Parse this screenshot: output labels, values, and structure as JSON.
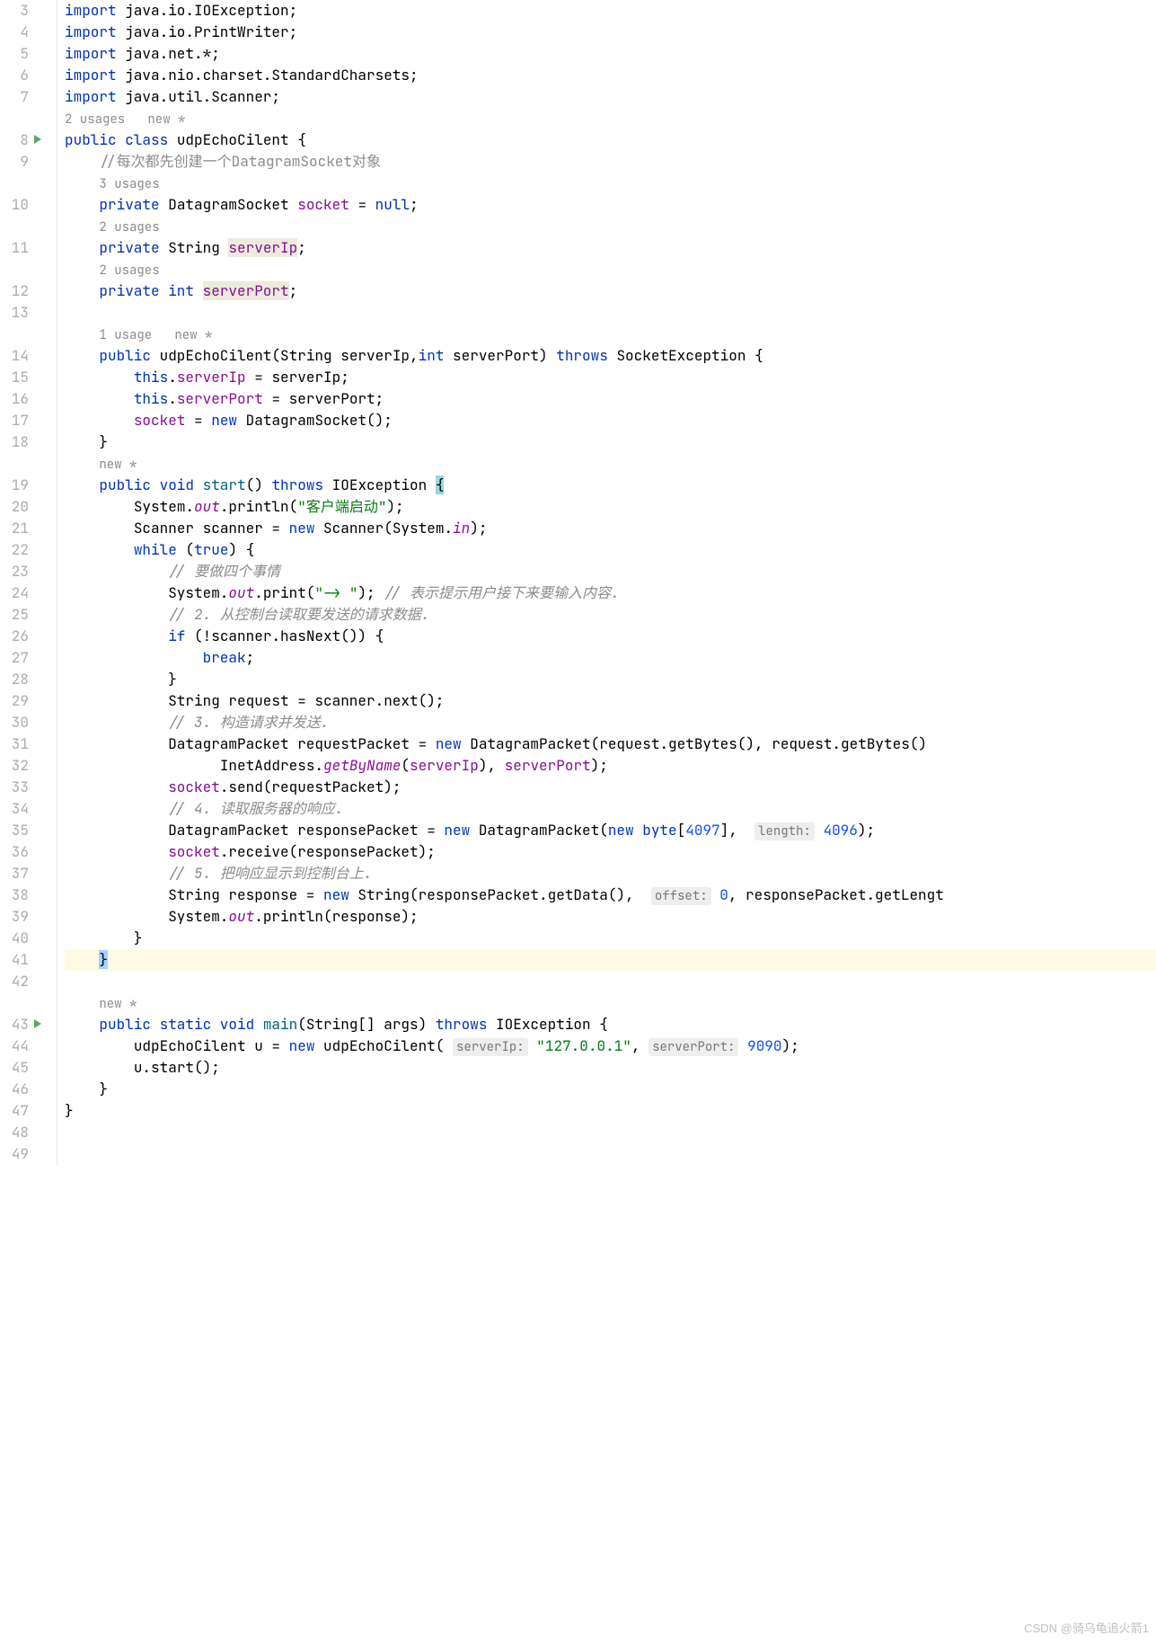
{
  "watermark": "CSDN @骑乌龟追火箭1",
  "lines": [
    {
      "num": "3",
      "indent": 0,
      "tokens": [
        {
          "t": "import ",
          "c": "kw"
        },
        {
          "t": "java.io.IOException;",
          "c": ""
        }
      ]
    },
    {
      "num": "4",
      "indent": 0,
      "tokens": [
        {
          "t": "import ",
          "c": "kw"
        },
        {
          "t": "java.io.PrintWriter;",
          "c": ""
        }
      ]
    },
    {
      "num": "5",
      "indent": 0,
      "tokens": [
        {
          "t": "import ",
          "c": "kw"
        },
        {
          "t": "java.net.*;",
          "c": ""
        }
      ]
    },
    {
      "num": "6",
      "indent": 0,
      "tokens": [
        {
          "t": "import ",
          "c": "kw"
        },
        {
          "t": "java.nio.charset.StandardCharsets;",
          "c": ""
        }
      ]
    },
    {
      "num": "7",
      "indent": 0,
      "tokens": [
        {
          "t": "import ",
          "c": "kw"
        },
        {
          "t": "java.util.Scanner;",
          "c": ""
        }
      ]
    },
    {
      "num": "",
      "indent": 0,
      "hint": true,
      "tokens": [
        {
          "t": "2 usages   new *",
          "c": "hint-line"
        }
      ]
    },
    {
      "num": "8",
      "indent": 0,
      "run": true,
      "tokens": [
        {
          "t": "public class ",
          "c": "kw"
        },
        {
          "t": "udpEchoCilent {",
          "c": ""
        }
      ]
    },
    {
      "num": "9",
      "indent": 1,
      "tokens": [
        {
          "t": "//每次都先创建一个DatagramSocket对象",
          "c": "comment-green"
        }
      ]
    },
    {
      "num": "",
      "indent": 1,
      "hint": true,
      "tokens": [
        {
          "t": "3 usages",
          "c": "hint-line"
        }
      ]
    },
    {
      "num": "10",
      "indent": 1,
      "tokens": [
        {
          "t": "private ",
          "c": "kw"
        },
        {
          "t": "DatagramSocket ",
          "c": ""
        },
        {
          "t": "socket",
          "c": "field"
        },
        {
          "t": " = ",
          "c": ""
        },
        {
          "t": "null",
          "c": "kw"
        },
        {
          "t": ";",
          "c": ""
        }
      ]
    },
    {
      "num": "",
      "indent": 1,
      "hint": true,
      "tokens": [
        {
          "t": "2 usages",
          "c": "hint-line"
        }
      ]
    },
    {
      "num": "11",
      "indent": 1,
      "tokens": [
        {
          "t": "private ",
          "c": "kw"
        },
        {
          "t": "String ",
          "c": ""
        },
        {
          "t": "serverIp",
          "c": "field usage-hl"
        },
        {
          "t": ";",
          "c": ""
        }
      ]
    },
    {
      "num": "",
      "indent": 1,
      "hint": true,
      "tokens": [
        {
          "t": "2 usages",
          "c": "hint-line"
        }
      ]
    },
    {
      "num": "12",
      "indent": 1,
      "tokens": [
        {
          "t": "private int ",
          "c": "kw"
        },
        {
          "t": "serverPort",
          "c": "field usage-hl"
        },
        {
          "t": ";",
          "c": ""
        }
      ]
    },
    {
      "num": "13",
      "indent": 0,
      "tokens": []
    },
    {
      "num": "",
      "indent": 1,
      "hint": true,
      "tokens": [
        {
          "t": "1 usage   new *",
          "c": "hint-line"
        }
      ]
    },
    {
      "num": "14",
      "indent": 1,
      "tokens": [
        {
          "t": "public ",
          "c": "kw"
        },
        {
          "t": "udpEchoCilent",
          "c": ""
        },
        {
          "t": "(String serverIp,",
          "c": ""
        },
        {
          "t": "int ",
          "c": "kw"
        },
        {
          "t": "serverPort) ",
          "c": ""
        },
        {
          "t": "throws ",
          "c": "kw"
        },
        {
          "t": "SocketException {",
          "c": ""
        }
      ]
    },
    {
      "num": "15",
      "indent": 2,
      "tokens": [
        {
          "t": "this",
          "c": "kw"
        },
        {
          "t": ".",
          "c": ""
        },
        {
          "t": "serverIp",
          "c": "field"
        },
        {
          "t": " = serverIp;",
          "c": ""
        }
      ]
    },
    {
      "num": "16",
      "indent": 2,
      "tokens": [
        {
          "t": "this",
          "c": "kw"
        },
        {
          "t": ".",
          "c": ""
        },
        {
          "t": "serverPort",
          "c": "field"
        },
        {
          "t": " = serverPort;",
          "c": ""
        }
      ]
    },
    {
      "num": "17",
      "indent": 2,
      "tokens": [
        {
          "t": "socket",
          "c": "field"
        },
        {
          "t": " = ",
          "c": ""
        },
        {
          "t": "new ",
          "c": "kw"
        },
        {
          "t": "DatagramSocket();",
          "c": ""
        }
      ]
    },
    {
      "num": "18",
      "indent": 1,
      "tokens": [
        {
          "t": "}",
          "c": ""
        }
      ]
    },
    {
      "num": "",
      "indent": 1,
      "hint": true,
      "tokens": [
        {
          "t": "new *",
          "c": "hint-line"
        }
      ]
    },
    {
      "num": "19",
      "indent": 1,
      "tokens": [
        {
          "t": "public void ",
          "c": "kw"
        },
        {
          "t": "start",
          "c": "method"
        },
        {
          "t": "() ",
          "c": ""
        },
        {
          "t": "throws ",
          "c": "kw"
        },
        {
          "t": "IOException ",
          "c": ""
        },
        {
          "t": "{",
          "c": "brace-hl"
        }
      ]
    },
    {
      "num": "20",
      "indent": 2,
      "tokens": [
        {
          "t": "System.",
          "c": ""
        },
        {
          "t": "out",
          "c": "static-field"
        },
        {
          "t": ".println(",
          "c": ""
        },
        {
          "t": "\"客户端启动\"",
          "c": "str"
        },
        {
          "t": ");",
          "c": ""
        }
      ]
    },
    {
      "num": "21",
      "indent": 2,
      "tokens": [
        {
          "t": "Scanner scanner = ",
          "c": ""
        },
        {
          "t": "new ",
          "c": "kw"
        },
        {
          "t": "Scanner(System.",
          "c": ""
        },
        {
          "t": "in",
          "c": "static-field"
        },
        {
          "t": ");",
          "c": ""
        }
      ]
    },
    {
      "num": "22",
      "indent": 2,
      "tokens": [
        {
          "t": "while ",
          "c": "kw"
        },
        {
          "t": "(",
          "c": ""
        },
        {
          "t": "true",
          "c": "kw"
        },
        {
          "t": ") {",
          "c": ""
        }
      ]
    },
    {
      "num": "23",
      "indent": 3,
      "tokens": [
        {
          "t": "// 要做四个事情",
          "c": "comment"
        }
      ]
    },
    {
      "num": "24",
      "indent": 3,
      "tokens": [
        {
          "t": "System.",
          "c": ""
        },
        {
          "t": "out",
          "c": "static-field"
        },
        {
          "t": ".print(",
          "c": ""
        },
        {
          "t": "\"-> \"",
          "c": "str"
        },
        {
          "t": "); ",
          "c": ""
        },
        {
          "t": "// 表示提示用户接下来要输入内容.",
          "c": "comment"
        }
      ]
    },
    {
      "num": "25",
      "indent": 3,
      "tokens": [
        {
          "t": "// 2. 从控制台读取要发送的请求数据.",
          "c": "comment"
        }
      ]
    },
    {
      "num": "26",
      "indent": 3,
      "tokens": [
        {
          "t": "if ",
          "c": "kw"
        },
        {
          "t": "(!scanner.hasNext()) {",
          "c": ""
        }
      ]
    },
    {
      "num": "27",
      "indent": 4,
      "tokens": [
        {
          "t": "break",
          "c": "kw"
        },
        {
          "t": ";",
          "c": ""
        }
      ]
    },
    {
      "num": "28",
      "indent": 3,
      "tokens": [
        {
          "t": "}",
          "c": ""
        }
      ]
    },
    {
      "num": "29",
      "indent": 3,
      "tokens": [
        {
          "t": "String request = scanner.next();",
          "c": ""
        }
      ]
    },
    {
      "num": "30",
      "indent": 3,
      "tokens": [
        {
          "t": "// 3. 构造请求并发送.",
          "c": "comment"
        }
      ]
    },
    {
      "num": "31",
      "indent": 3,
      "tokens": [
        {
          "t": "DatagramPacket requestPacket = ",
          "c": ""
        },
        {
          "t": "new ",
          "c": "kw"
        },
        {
          "t": "DatagramPacket(request.getBytes(), request.getBytes()",
          "c": ""
        }
      ]
    },
    {
      "num": "32",
      "indent": 5,
      "tokens": [
        {
          "t": "InetAddress.",
          "c": ""
        },
        {
          "t": "getByName",
          "c": "static-field"
        },
        {
          "t": "(",
          "c": ""
        },
        {
          "t": "serverIp",
          "c": "field"
        },
        {
          "t": "), ",
          "c": ""
        },
        {
          "t": "serverPort",
          "c": "field"
        },
        {
          "t": ");",
          "c": ""
        }
      ]
    },
    {
      "num": "33",
      "indent": 3,
      "tokens": [
        {
          "t": "socket",
          "c": "field"
        },
        {
          "t": ".send(requestPacket);",
          "c": ""
        }
      ]
    },
    {
      "num": "34",
      "indent": 3,
      "tokens": [
        {
          "t": "// 4. 读取服务器的响应.",
          "c": "comment"
        }
      ]
    },
    {
      "num": "35",
      "indent": 3,
      "tokens": [
        {
          "t": "DatagramPacket responsePacket = ",
          "c": ""
        },
        {
          "t": "new ",
          "c": "kw"
        },
        {
          "t": "DatagramPacket(",
          "c": ""
        },
        {
          "t": "new byte",
          "c": "kw"
        },
        {
          "t": "[",
          "c": ""
        },
        {
          "t": "4097",
          "c": "num"
        },
        {
          "t": "],  ",
          "c": ""
        },
        {
          "t": "length:",
          "c": "param-hint"
        },
        {
          "t": " ",
          "c": ""
        },
        {
          "t": "4096",
          "c": "num"
        },
        {
          "t": ");",
          "c": ""
        }
      ]
    },
    {
      "num": "36",
      "indent": 3,
      "tokens": [
        {
          "t": "socket",
          "c": "field"
        },
        {
          "t": ".receive(responsePacket);",
          "c": ""
        }
      ]
    },
    {
      "num": "37",
      "indent": 3,
      "tokens": [
        {
          "t": "// 5. 把响应显示到控制台上.",
          "c": "comment"
        }
      ]
    },
    {
      "num": "38",
      "indent": 3,
      "tokens": [
        {
          "t": "String response = ",
          "c": ""
        },
        {
          "t": "new ",
          "c": "kw"
        },
        {
          "t": "String(responsePacket.getData(),  ",
          "c": ""
        },
        {
          "t": "offset:",
          "c": "param-hint"
        },
        {
          "t": " ",
          "c": ""
        },
        {
          "t": "0",
          "c": "num"
        },
        {
          "t": ", responsePacket.getLengt",
          "c": ""
        }
      ]
    },
    {
      "num": "39",
      "indent": 3,
      "tokens": [
        {
          "t": "System.",
          "c": ""
        },
        {
          "t": "out",
          "c": "static-field"
        },
        {
          "t": ".println(response);",
          "c": ""
        }
      ]
    },
    {
      "num": "40",
      "indent": 2,
      "tokens": [
        {
          "t": "}",
          "c": ""
        }
      ]
    },
    {
      "num": "41",
      "indent": 1,
      "highlight": true,
      "tokens": [
        {
          "t": "}",
          "c": "cursor-bracket"
        }
      ]
    },
    {
      "num": "42",
      "indent": 0,
      "tokens": []
    },
    {
      "num": "",
      "indent": 1,
      "hint": true,
      "tokens": [
        {
          "t": "new *",
          "c": "hint-line"
        }
      ]
    },
    {
      "num": "43",
      "indent": 1,
      "run": true,
      "tokens": [
        {
          "t": "public static void ",
          "c": "kw"
        },
        {
          "t": "main",
          "c": "method"
        },
        {
          "t": "(String[] args) ",
          "c": ""
        },
        {
          "t": "throws ",
          "c": "kw"
        },
        {
          "t": "IOException {",
          "c": ""
        }
      ]
    },
    {
      "num": "44",
      "indent": 2,
      "tokens": [
        {
          "t": "udpEchoCilent u = ",
          "c": ""
        },
        {
          "t": "new ",
          "c": "kw"
        },
        {
          "t": "udpEchoCilent( ",
          "c": ""
        },
        {
          "t": "serverIp:",
          "c": "param-hint"
        },
        {
          "t": " ",
          "c": ""
        },
        {
          "t": "\"127.0.0.1\"",
          "c": "str"
        },
        {
          "t": ", ",
          "c": ""
        },
        {
          "t": "serverPort:",
          "c": "param-hint"
        },
        {
          "t": " ",
          "c": ""
        },
        {
          "t": "9090",
          "c": "num"
        },
        {
          "t": ");",
          "c": ""
        }
      ]
    },
    {
      "num": "45",
      "indent": 2,
      "tokens": [
        {
          "t": "u.start();",
          "c": ""
        }
      ]
    },
    {
      "num": "46",
      "indent": 1,
      "tokens": [
        {
          "t": "}",
          "c": ""
        }
      ]
    },
    {
      "num": "47",
      "indent": 0,
      "tokens": [
        {
          "t": "}",
          "c": ""
        }
      ]
    },
    {
      "num": "48",
      "indent": 0,
      "tokens": []
    },
    {
      "num": "49",
      "indent": 0,
      "tokens": []
    }
  ]
}
